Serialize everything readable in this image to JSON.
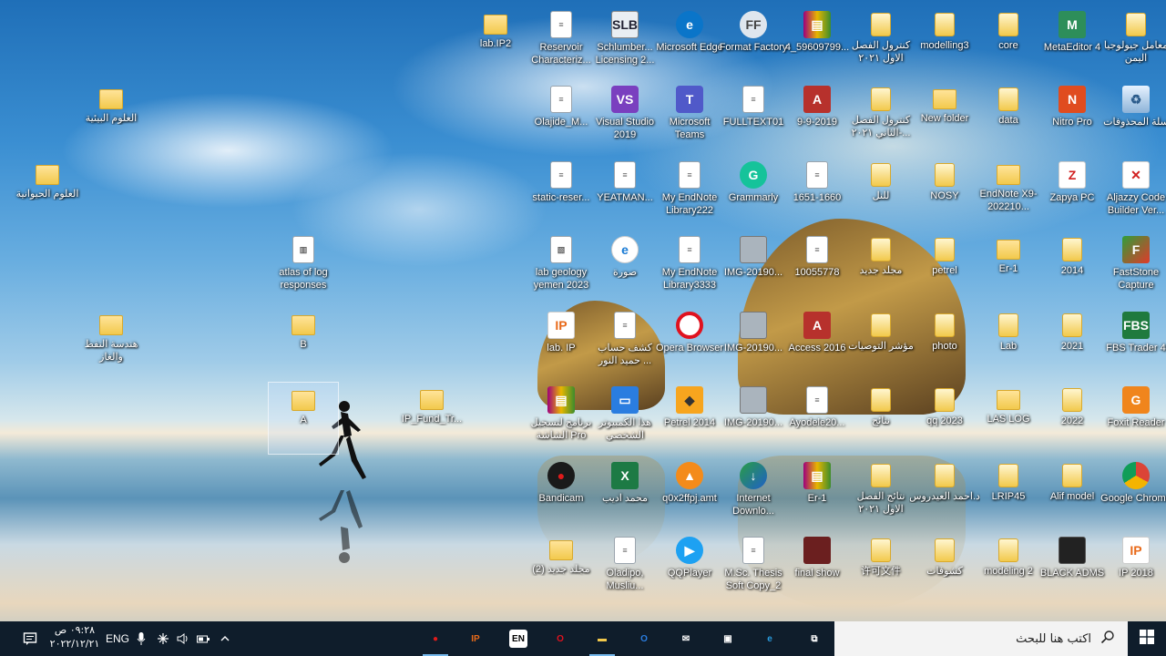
{
  "desktop": {
    "icons": [
      {
        "label": "lab.IP2",
        "glyph": "folder-icon",
        "type": "folder",
        "glyph_text": ""
      },
      {
        "label": "Reservoir Characteriz...",
        "glyph": "document-icon",
        "type": "doc",
        "glyph_text": "≡"
      },
      {
        "label": "Schlumber... Licensing 2...",
        "glyph": "slb-icon",
        "type": "slb",
        "glyph_text": "SLB"
      },
      {
        "label": "Microsoft Edge",
        "glyph": "edge-icon",
        "type": "edge",
        "glyph_text": "e"
      },
      {
        "label": "Format Factory",
        "glyph": "format-factory-icon",
        "type": "format",
        "glyph_text": "FF"
      },
      {
        "label": "4_59609799...",
        "glyph": "winrar-icon",
        "type": "winrar",
        "glyph_text": "▤"
      },
      {
        "label": "كنترول الفصل الاول ٢٠٢١",
        "glyph": "folder-doc-icon",
        "type": "folderdoc",
        "glyph_text": ""
      },
      {
        "label": "modelling3",
        "glyph": "folder-doc-icon",
        "type": "folderdoc",
        "glyph_text": ""
      },
      {
        "label": "core",
        "glyph": "folder-doc-icon",
        "type": "folderdoc",
        "glyph_text": ""
      },
      {
        "label": "MetaEditor 4",
        "glyph": "metaeditor-icon",
        "type": "metaeditor",
        "glyph_text": "M"
      },
      {
        "label": "معامل جيولوجيا اليمن",
        "glyph": "folder-doc-icon",
        "type": "folderdoc",
        "glyph_text": ""
      },
      {
        "label": "العلوم البيئية",
        "glyph": "folder-icon",
        "type": "folder",
        "glyph_text": ""
      },
      {
        "label": "Olajide_M...",
        "glyph": "document-icon",
        "type": "doc",
        "glyph_text": "≡"
      },
      {
        "label": "Visual Studio 2019",
        "glyph": "visual-studio-icon",
        "type": "vs",
        "glyph_text": "VS"
      },
      {
        "label": "Microsoft Teams",
        "glyph": "teams-icon",
        "type": "teams",
        "glyph_text": "T"
      },
      {
        "label": "FULLTEXT01",
        "glyph": "document-icon",
        "type": "doc",
        "glyph_text": "≡"
      },
      {
        "label": "9-9-2019",
        "glyph": "access-icon",
        "type": "access",
        "glyph_text": "A"
      },
      {
        "label": "كنترول الفصل الثاني ٢٠٢١-...",
        "glyph": "folder-doc-icon",
        "type": "folderdoc",
        "glyph_text": ""
      },
      {
        "label": "New folder",
        "glyph": "folder-icon",
        "type": "folder",
        "glyph_text": ""
      },
      {
        "label": "data",
        "glyph": "folder-doc-icon",
        "type": "folderdoc",
        "glyph_text": ""
      },
      {
        "label": "Nitro Pro",
        "glyph": "nitro-icon",
        "type": "nitro",
        "glyph_text": "N"
      },
      {
        "label": "سلة المحذوفات",
        "glyph": "recycle-bin-icon",
        "type": "recycle",
        "glyph_text": "♻"
      },
      {
        "label": "العلوم الحيوانية",
        "glyph": "folder-icon",
        "type": "folder",
        "glyph_text": ""
      },
      {
        "label": "static-reser...",
        "glyph": "document-icon",
        "type": "doc",
        "glyph_text": "≡"
      },
      {
        "label": "YEATMAN...",
        "glyph": "document-icon",
        "type": "doc",
        "glyph_text": "≡"
      },
      {
        "label": "My EndNote Library222",
        "glyph": "document-icon",
        "type": "doc",
        "glyph_text": "≡"
      },
      {
        "label": "Grammarly",
        "glyph": "grammarly-icon",
        "type": "grammarly",
        "glyph_text": "G"
      },
      {
        "label": "1651-1660",
        "glyph": "document-icon",
        "type": "doc",
        "glyph_text": "≡"
      },
      {
        "label": "للنل",
        "glyph": "folder-doc-icon",
        "type": "folderdoc",
        "glyph_text": ""
      },
      {
        "label": "NOSY",
        "glyph": "folder-doc-icon",
        "type": "folderdoc",
        "glyph_text": ""
      },
      {
        "label": "EndNote X9-202210...",
        "glyph": "folder-icon",
        "type": "folder",
        "glyph_text": ""
      },
      {
        "label": "Zapya PC",
        "glyph": "zapya-icon",
        "type": "zapya",
        "glyph_text": "Z"
      },
      {
        "label": "Aljazzy Code Builder Ver...",
        "glyph": "aljazzy-icon",
        "type": "aljazzy",
        "glyph_text": "✕"
      },
      {
        "label": "atlas of log responses",
        "glyph": "book-icon",
        "type": "doc",
        "glyph_text": "▥"
      },
      {
        "label": "lab geology yemen 2023",
        "glyph": "image-doc-icon",
        "type": "doc",
        "glyph_text": "▧"
      },
      {
        "label": "صورة",
        "glyph": "internet-explorer-icon",
        "type": "ie",
        "glyph_text": "e"
      },
      {
        "label": "My EndNote Library3333",
        "glyph": "document-icon",
        "type": "doc",
        "glyph_text": "≡"
      },
      {
        "label": "IMG-20190...",
        "glyph": "image-icon",
        "type": "image",
        "glyph_text": ""
      },
      {
        "label": "10055778",
        "glyph": "document-icon",
        "type": "doc",
        "glyph_text": "≡"
      },
      {
        "label": "مجلد جديد",
        "glyph": "folder-doc-icon",
        "type": "folderdoc",
        "glyph_text": ""
      },
      {
        "label": "petrel",
        "glyph": "folder-doc-icon",
        "type": "folderdoc",
        "glyph_text": ""
      },
      {
        "label": "Er-1",
        "glyph": "folder-icon",
        "type": "folder",
        "glyph_text": ""
      },
      {
        "label": "2014",
        "glyph": "folder-doc-icon",
        "type": "folderdoc",
        "glyph_text": ""
      },
      {
        "label": "FastStone Capture",
        "glyph": "faststone-icon",
        "type": "faststone",
        "glyph_text": "F"
      },
      {
        "label": "هندسة النفط والغاز",
        "glyph": "folder-icon",
        "type": "folder",
        "glyph_text": ""
      },
      {
        "label": "B",
        "glyph": "folder-icon",
        "type": "folder",
        "glyph_text": ""
      },
      {
        "label": "lab. IP",
        "glyph": "ip-icon",
        "type": "ip",
        "glyph_text": "IP"
      },
      {
        "label": "كشف حساب حميد النور ...",
        "glyph": "document-icon",
        "type": "doc",
        "glyph_text": "≡"
      },
      {
        "label": "Opera Browser",
        "glyph": "opera-icon",
        "type": "opera",
        "glyph_text": ""
      },
      {
        "label": "IMG-20190...",
        "glyph": "image-icon",
        "type": "image",
        "glyph_text": ""
      },
      {
        "label": "Access 2016",
        "glyph": "access-icon",
        "type": "access",
        "glyph_text": "A"
      },
      {
        "label": "مؤشر التوصيات",
        "glyph": "folder-doc-icon",
        "type": "folderdoc",
        "glyph_text": ""
      },
      {
        "label": "photo",
        "glyph": "folder-doc-icon",
        "type": "folderdoc",
        "glyph_text": ""
      },
      {
        "label": "Lab",
        "glyph": "folder-doc-icon",
        "type": "folderdoc",
        "glyph_text": ""
      },
      {
        "label": "2021",
        "glyph": "folder-doc-icon",
        "type": "folderdoc",
        "glyph_text": ""
      },
      {
        "label": "FBS Trader 4",
        "glyph": "fbs-icon",
        "type": "fbs",
        "glyph_text": "FBS"
      },
      {
        "label": "A",
        "glyph": "folder-icon",
        "type": "folder",
        "glyph_text": ""
      },
      {
        "label": "IP_Fund_Tr...",
        "glyph": "folder-icon",
        "type": "folder",
        "glyph_text": ""
      },
      {
        "label": "برنامج لتسجيل الشاشة Pro",
        "glyph": "winrar-icon",
        "type": "winrar",
        "glyph_text": "▤"
      },
      {
        "label": "هذا الكمبيوتر الشخصي",
        "glyph": "computer-icon",
        "type": "computer",
        "glyph_text": "▭"
      },
      {
        "label": "Petrel 2014",
        "glyph": "petrel-icon",
        "type": "petrel",
        "glyph_text": "◆"
      },
      {
        "label": "IMG-20190...",
        "glyph": "image-icon",
        "type": "image",
        "glyph_text": ""
      },
      {
        "label": "Ayodele20...",
        "glyph": "document-icon",
        "type": "doc",
        "glyph_text": "≡"
      },
      {
        "label": "نتائج",
        "glyph": "folder-doc-icon",
        "type": "folderdoc",
        "glyph_text": ""
      },
      {
        "label": "qq 2023",
        "glyph": "folder-doc-icon",
        "type": "folderdoc",
        "glyph_text": ""
      },
      {
        "label": "LAS LOG",
        "glyph": "folder-icon",
        "type": "folder",
        "glyph_text": ""
      },
      {
        "label": "2022",
        "glyph": "folder-doc-icon",
        "type": "folderdoc",
        "glyph_text": ""
      },
      {
        "label": "Foxit Reader",
        "glyph": "foxit-icon",
        "type": "foxit",
        "glyph_text": "G"
      },
      {
        "label": "Bandicam",
        "glyph": "bandicam-icon",
        "type": "bandicam",
        "glyph_text": "●"
      },
      {
        "label": "محمد اديب",
        "glyph": "excel-icon",
        "type": "excel",
        "glyph_text": "X"
      },
      {
        "label": "q0x2ffpj.amt",
        "glyph": "vlc-icon",
        "type": "vlc",
        "glyph_text": "▲"
      },
      {
        "label": "Internet Downlo...",
        "glyph": "idm-icon",
        "type": "idm",
        "glyph_text": "↓"
      },
      {
        "label": "Er-1",
        "glyph": "winrar-icon",
        "type": "winrar",
        "glyph_text": "▤"
      },
      {
        "label": "نتائج الفصل الاول ٢٠٢١",
        "glyph": "folder-doc-icon",
        "type": "folderdoc",
        "glyph_text": ""
      },
      {
        "label": "د.احمد العيدروس",
        "glyph": "folder-doc-icon",
        "type": "folderdoc",
        "glyph_text": ""
      },
      {
        "label": "LRIP45",
        "glyph": "folder-doc-icon",
        "type": "folderdoc",
        "glyph_text": ""
      },
      {
        "label": "Alif model",
        "glyph": "folder-doc-icon",
        "type": "folderdoc",
        "glyph_text": ""
      },
      {
        "label": "Google Chrome",
        "glyph": "chrome-icon",
        "type": "chrome",
        "glyph_text": ""
      },
      {
        "label": "مجلد جديد (2)",
        "glyph": "folder-icon",
        "type": "folder",
        "glyph_text": ""
      },
      {
        "label": "Oladipo, Musliu...",
        "glyph": "document-icon",
        "type": "doc",
        "glyph_text": "≡"
      },
      {
        "label": "QQPlayer",
        "glyph": "qqplayer-icon",
        "type": "qq",
        "glyph_text": "▶"
      },
      {
        "label": "M.Sc. Thesis Soft Copy_2",
        "glyph": "document-icon",
        "type": "doc",
        "glyph_text": "≡"
      },
      {
        "label": "final show",
        "glyph": "video-icon",
        "type": "video",
        "glyph_text": ""
      },
      {
        "label": "许可文件",
        "glyph": "folder-doc-icon",
        "type": "folderdoc",
        "glyph_text": ""
      },
      {
        "label": "كشوفات",
        "glyph": "folder-doc-icon",
        "type": "folderdoc",
        "glyph_text": ""
      },
      {
        "label": "modeling 2",
        "glyph": "folder-doc-icon",
        "type": "folderdoc",
        "glyph_text": ""
      },
      {
        "label": "BLACK ADMS",
        "glyph": "black-folder-icon",
        "type": "black",
        "glyph_text": ""
      },
      {
        "label": "IP 2018",
        "glyph": "ip-icon",
        "type": "ip",
        "glyph_text": "IP"
      }
    ]
  },
  "taskbar": {
    "search_placeholder": "اكتب هنا للبحث",
    "clock_time": "٠٩:٢٨ ص",
    "clock_date": "٢٠٢٢/١٢/٢١",
    "language": "ENG",
    "ime_badge": "EN",
    "apps": [
      {
        "name": "bandicam-taskbar-icon",
        "glyph": "●",
        "color": "#e01b1b"
      },
      {
        "name": "ip-taskbar-icon",
        "glyph": "IP",
        "color": "#e86a1a"
      },
      {
        "name": "language-bar-icon",
        "glyph": "EN",
        "color": "#ffffff"
      },
      {
        "name": "opera-taskbar-icon",
        "glyph": "O",
        "color": "#e0121f"
      },
      {
        "name": "file-explorer-taskbar-icon",
        "glyph": "▬",
        "color": "#f2c94c"
      },
      {
        "name": "outlook-taskbar-icon",
        "glyph": "O",
        "color": "#2a7de0"
      },
      {
        "name": "mail-taskbar-icon",
        "glyph": "✉",
        "color": "#ffffff"
      },
      {
        "name": "store-taskbar-icon",
        "glyph": "▣",
        "color": "#ffffff"
      },
      {
        "name": "edge-taskbar-icon",
        "glyph": "e",
        "color": "#2a9de0"
      },
      {
        "name": "task-view-taskbar-icon",
        "glyph": "⧉",
        "color": "#ffffff"
      }
    ]
  },
  "colors": {
    "taskbar_bg": "#0f1d2b",
    "search_bg": "#f3f3f3",
    "label_text": "#ffffff"
  }
}
